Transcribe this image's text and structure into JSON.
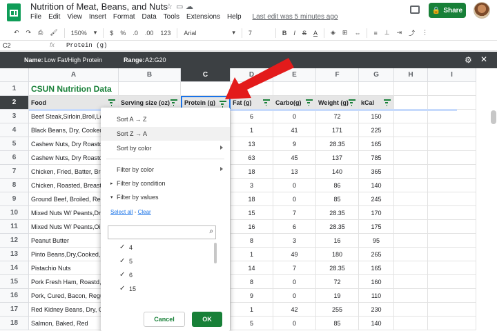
{
  "app": {
    "doc_title": "Nutrition of Meat, Beans, and Nuts",
    "menu": [
      "File",
      "Edit",
      "View",
      "Insert",
      "Format",
      "Data",
      "Tools",
      "Extensions",
      "Help"
    ],
    "last_edit": "Last edit was 5 minutes ago",
    "share_label": "Share",
    "brand_color": "#188038"
  },
  "toolbar": {
    "zoom": "150%",
    "currency": "$",
    "percent": "%",
    "decimal_less": ".0",
    "decimal_more": ".00",
    "number_format": "123",
    "font": "Arial",
    "font_size": "7",
    "bold": "B",
    "italic": "I",
    "strike": "S",
    "text_color": "A"
  },
  "formula_bar": {
    "cell_ref": "C2",
    "fx": "fx",
    "formula": "Protein (g)"
  },
  "filter_view": {
    "name_label": "Name:",
    "name": "Low Fat/High Protein",
    "range_label": "Range:",
    "range": "A2:G20"
  },
  "columns": [
    "A",
    "B",
    "C",
    "D",
    "E",
    "F",
    "G",
    "H",
    "I"
  ],
  "rows": [
    "1",
    "2",
    "3",
    "4",
    "5",
    "6",
    "7",
    "8",
    "9",
    "10",
    "11",
    "12",
    "13",
    "14",
    "15",
    "16",
    "17",
    "18"
  ],
  "sheet": {
    "title": "CSUN Nutrition Data",
    "headers": [
      "Food",
      "Serving size (oz)",
      "Protein (g)",
      "Fat (g)",
      "Carbo(g)",
      "Weight (g)",
      "kCal"
    ],
    "data": [
      [
        "Beef Steak,Sirloin,Broil,Lean",
        "6",
        "0",
        "72",
        "150"
      ],
      [
        "Black Beans, Dry, Cooked, Dr",
        "1",
        "41",
        "171",
        "225"
      ],
      [
        "Cashew Nuts, Dry Roastd,Sal",
        "13",
        "9",
        "28.35",
        "165"
      ],
      [
        "Cashew Nuts, Dry Roastd,Un",
        "63",
        "45",
        "137",
        "785"
      ],
      [
        "Chicken, Fried, Batter, Breast",
        "18",
        "13",
        "140",
        "365"
      ],
      [
        "Chicken, Roasted, Breast",
        "3",
        "0",
        "86",
        "140"
      ],
      [
        "Ground Beef, Broiled, Regular",
        "18",
        "0",
        "85",
        "245"
      ],
      [
        "Mixed Nuts W/ Peants,Dry,Sa",
        "15",
        "7",
        "28.35",
        "170"
      ],
      [
        "Mixed Nuts W/ Peants,Oil,Sa",
        "16",
        "6",
        "28.35",
        "175"
      ],
      [
        "Peanut Butter",
        "8",
        "3",
        "16",
        "95"
      ],
      [
        "Pinto Beans,Dry,Cooked,Dr",
        "1",
        "49",
        "180",
        "265"
      ],
      [
        "Pistachio Nuts",
        "14",
        "7",
        "28.35",
        "165"
      ],
      [
        "Pork Fresh Ham, Roastd, Lean",
        "8",
        "0",
        "72",
        "160"
      ],
      [
        "Pork, Cured, Bacon, Regular",
        "9",
        "0",
        "19",
        "110"
      ],
      [
        "Red Kidney Beans, Dry, Cann",
        "1",
        "42",
        "255",
        "230"
      ],
      [
        "Salmon, Baked, Red",
        "5",
        "0",
        "85",
        "140"
      ]
    ]
  },
  "filter_menu": {
    "sort_az": "Sort A → Z",
    "sort_za": "Sort Z → A",
    "sort_color": "Sort by color",
    "filter_color": "Filter by color",
    "filter_condition": "Filter by condition",
    "filter_values": "Filter by values",
    "select_all": "Select all",
    "dash": " - ",
    "clear": "Clear",
    "values": [
      "4",
      "5",
      "6",
      "15"
    ],
    "check": "✓",
    "cancel": "Cancel",
    "ok": "OK"
  }
}
